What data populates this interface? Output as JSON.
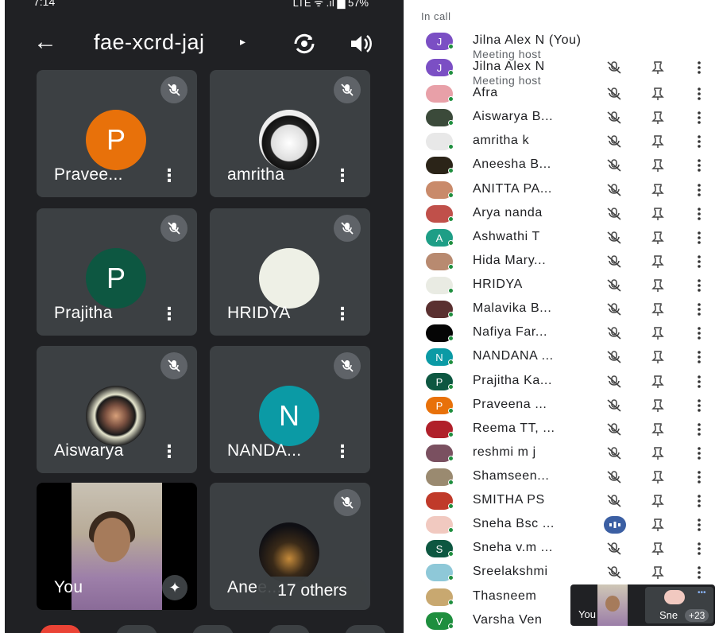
{
  "status_bar": {
    "time": "7:14",
    "right": "LTE ᯤ .ıl ▆ 57%"
  },
  "header": {
    "title": "fae-xcrd-jaj",
    "caret": "▸",
    "back": "←"
  },
  "tiles": [
    {
      "name": "Pravee...",
      "initial": "P",
      "color": "#e8710a",
      "type": "initial"
    },
    {
      "name": "amritha",
      "initial": "",
      "color": "#ffffff",
      "type": "photo-chaplin"
    },
    {
      "name": "Prajitha",
      "initial": "P",
      "color": "#0d5741",
      "type": "initial"
    },
    {
      "name": "HRIDYA",
      "initial": "",
      "color": "#eef0e6",
      "type": "blank"
    },
    {
      "name": "Aiswarya",
      "initial": "",
      "color": "#2a2a2a",
      "type": "photo-flowers"
    },
    {
      "name": "NANDA...",
      "initial": "N",
      "color": "#0b9aa5",
      "type": "initial"
    }
  ],
  "you_tile": {
    "name": "You",
    "sparkle": "✦"
  },
  "others_tile": {
    "name": "Anee...",
    "pill": "17 others"
  },
  "panel": {
    "section": "In call",
    "participants": [
      {
        "name": "Jilna Alex N (You)",
        "role": "Meeting host",
        "avatar": "J",
        "color": "#7b4fc4",
        "controls": false
      },
      {
        "name": "Jilna Alex N",
        "role": "Meeting host",
        "avatar": "J",
        "color": "#7b4fc4",
        "controls": true
      },
      {
        "name": "Afra",
        "avatar": "",
        "color": "#e8a0a8",
        "controls": true
      },
      {
        "name": "Aiswarya B...",
        "avatar": "",
        "color": "#3b4a3a",
        "controls": true
      },
      {
        "name": "amritha k",
        "avatar": "",
        "color": "#e8e8e8",
        "controls": true
      },
      {
        "name": "Aneesha B...",
        "avatar": "",
        "color": "#2b2418",
        "controls": true
      },
      {
        "name": "ANITTA PA...",
        "avatar": "",
        "color": "#c98a6a",
        "controls": true
      },
      {
        "name": "Arya nanda",
        "avatar": "",
        "color": "#c0504a",
        "controls": true
      },
      {
        "name": "Ashwathi T",
        "avatar": "A",
        "color": "#1e9e86",
        "controls": true
      },
      {
        "name": "Hida Mary...",
        "avatar": "",
        "color": "#b88a70",
        "controls": true
      },
      {
        "name": "HRIDYA",
        "avatar": "",
        "color": "#e9ebe3",
        "controls": true
      },
      {
        "name": "Malavika B...",
        "avatar": "",
        "color": "#5a3030",
        "controls": true
      },
      {
        "name": "Nafiya Far...",
        "avatar": "",
        "color": "#050505",
        "controls": true
      },
      {
        "name": "NANDANA ...",
        "avatar": "N",
        "color": "#0b9aa5",
        "controls": true
      },
      {
        "name": "Prajitha Ka...",
        "avatar": "P",
        "color": "#0d5741",
        "controls": true
      },
      {
        "name": "Praveena ...",
        "avatar": "P",
        "color": "#e8710a",
        "controls": true
      },
      {
        "name": "Reema TT, ...",
        "avatar": "",
        "color": "#b0202a",
        "controls": true
      },
      {
        "name": "reshmi m j",
        "avatar": "",
        "color": "#7a5060",
        "controls": true
      },
      {
        "name": "Shamseen...",
        "avatar": "",
        "color": "#9a8a70",
        "controls": true
      },
      {
        "name": "SMITHA PS",
        "avatar": "",
        "color": "#c03a2a",
        "controls": true
      },
      {
        "name": "Sneha Bsc ...",
        "avatar": "",
        "color": "#f1c9c0",
        "controls": true,
        "speaking": true
      },
      {
        "name": "Sneha v.m ...",
        "avatar": "S",
        "color": "#0d5741",
        "controls": true
      },
      {
        "name": "Sreelakshmi",
        "avatar": "",
        "color": "#8ec8d8",
        "controls": true
      },
      {
        "name": "Thasneem",
        "avatar": "",
        "color": "#c8a870",
        "controls": false
      },
      {
        "name": "Varsha Ven",
        "avatar": "V",
        "color": "#1e8e3e",
        "controls": false
      }
    ]
  },
  "pip": {
    "you": "You",
    "sneha": "Sne",
    "plus": "+23",
    "dots": "•••"
  }
}
